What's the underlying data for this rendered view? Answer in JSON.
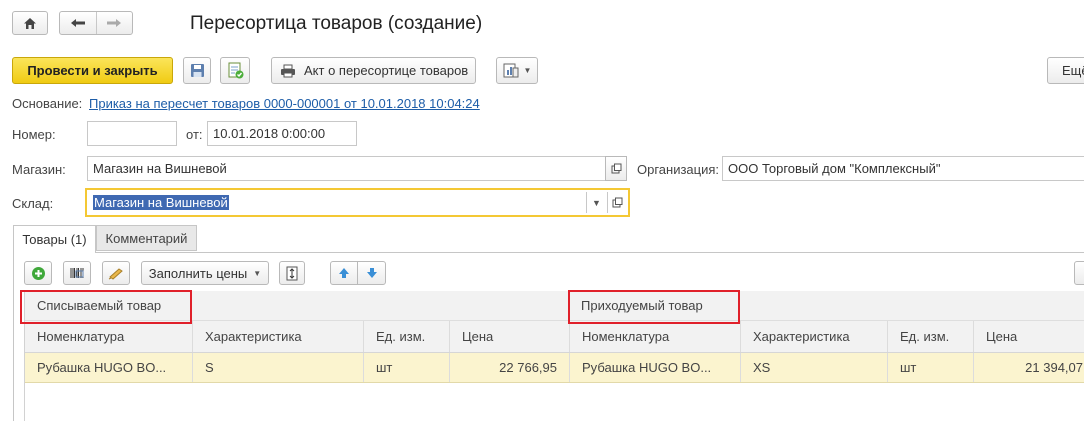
{
  "window": {
    "title": "Пересортица товаров (создание)"
  },
  "toolbar": {
    "post_close_label": "Провести и закрыть",
    "print_act_label": "Акт о пересортице товаров",
    "more_label": "Ещё"
  },
  "header": {
    "basis_label": "Основание:",
    "basis_link": "Приказ на пересчет товаров 0000-000001 от 10.01.2018 10:04:24",
    "number_label": "Номер:",
    "number_value": "",
    "from_label": "от:",
    "date_value": "10.01.2018  0:00:00",
    "store_label": "Магазин:",
    "store_value": "Магазин на Вишневой",
    "org_label": "Организация:",
    "org_value": "ООО Торговый дом \"Комплексный\"",
    "warehouse_label": "Склад:",
    "warehouse_value": "Магазин на Вишневой"
  },
  "tabs": [
    {
      "label": "Товары (1)",
      "active": true
    },
    {
      "label": "Комментарий",
      "active": false
    }
  ],
  "table_toolbar": {
    "fill_prices_label": "Заполнить цены"
  },
  "table": {
    "group_headers": [
      "Списываемый товар",
      "Приходуемый товар"
    ],
    "columns": [
      "Номенклатура",
      "Характеристика",
      "Ед. изм.",
      "Цена",
      "Номенклатура",
      "Характеристика",
      "Ед. изм.",
      "Цена"
    ],
    "rows": [
      [
        "Рубашка HUGO BO...",
        "S",
        "шт",
        "22 766,95",
        "Рубашка HUGO BO...",
        "XS",
        "шт",
        "21 394,07"
      ]
    ]
  },
  "colors": {
    "accent_yellow": "#f4c834",
    "highlight_red": "#e0202a",
    "link_blue": "#1d5da8",
    "selected_row": "#fbf4cf"
  },
  "icons": [
    "home-icon",
    "back-arrow-icon",
    "forward-arrow-icon",
    "save-icon",
    "post-icon",
    "printer-icon",
    "report-icon",
    "add-icon",
    "barcode-icon",
    "pick-icon",
    "size-icon",
    "move-up-icon",
    "move-down-icon",
    "open-icon",
    "dropdown-icon"
  ]
}
